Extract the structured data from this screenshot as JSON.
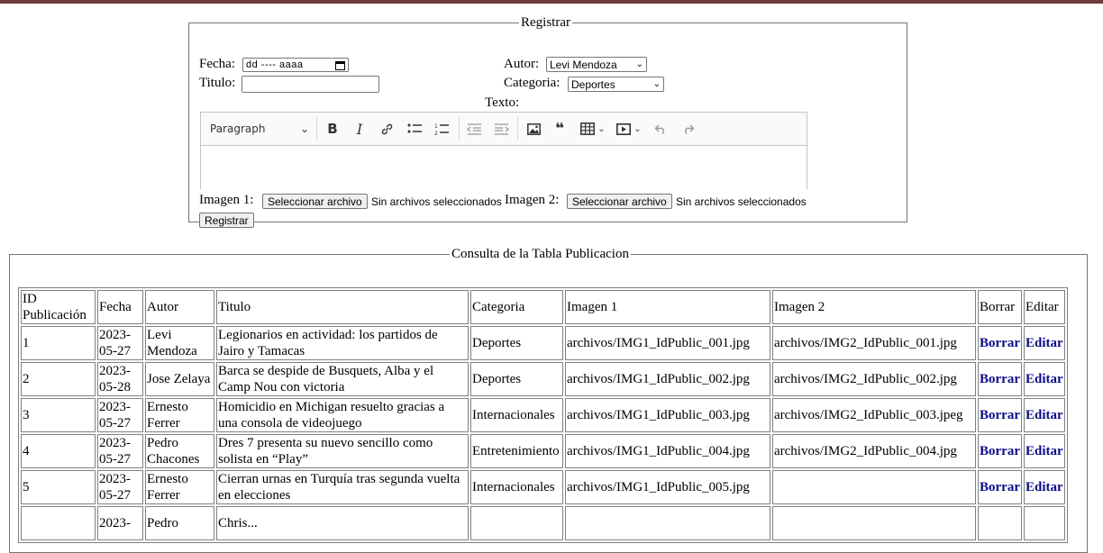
{
  "registro": {
    "legend": "Registrar",
    "fecha_label": "Fecha:",
    "fecha_placeholder": "dd ---- aaaa",
    "autor_label": "Autor:",
    "autor_value": "Levi Mendoza",
    "titulo_label": "Titulo:",
    "titulo_value": "",
    "categoria_label": "Categoria:",
    "categoria_value": "Deportes",
    "texto_label": "Texto:",
    "editor": {
      "heading_select": "Paragraph",
      "tools": [
        "bold-icon",
        "italic-icon",
        "link-icon",
        "bulleted-list-icon",
        "numbered-list-icon",
        "outdent-icon",
        "indent-icon",
        "image-icon",
        "blockquote-icon",
        "table-icon",
        "media-icon",
        "undo-icon",
        "redo-icon"
      ]
    },
    "imagen1_label": "Imagen 1:",
    "imagen2_label": "Imagen 2:",
    "file_button": "Seleccionar archivo",
    "file_status": "Sin archivos seleccionados",
    "submit_label": "Registrar"
  },
  "consulta": {
    "legend": "Consulta de la Tabla Publicacion",
    "headers": [
      "ID Publicación",
      "Fecha",
      "Autor",
      "Titulo",
      "Categoria",
      "Imagen 1",
      "Imagen 2",
      "Borrar",
      "Editar"
    ],
    "rows": [
      {
        "id": "1",
        "fecha": "2023-05-27",
        "autor": "Levi Mendoza",
        "titulo": "Legionarios en actividad: los partidos de Jairo y Tamacas",
        "categoria": "Deportes",
        "imagen1": "archivos/IMG1_IdPublic_001.jpg",
        "imagen2": "archivos/IMG2_IdPublic_001.jpg",
        "borrar": "Borrar",
        "editar": "Editar"
      },
      {
        "id": "2",
        "fecha": "2023-05-28",
        "autor": "Jose Zelaya",
        "titulo": "Barca se despide de Busquets, Alba y el Camp Nou con victoria",
        "categoria": "Deportes",
        "imagen1": "archivos/IMG1_IdPublic_002.jpg",
        "imagen2": "archivos/IMG2_IdPublic_002.jpg",
        "borrar": "Borrar",
        "editar": "Editar"
      },
      {
        "id": "3",
        "fecha": "2023-05-27",
        "autor": "Ernesto Ferrer",
        "titulo": "Homicidio en Michigan resuelto gracias a una consola de videojuego",
        "categoria": "Internacionales",
        "imagen1": "archivos/IMG1_IdPublic_003.jpg",
        "imagen2": "archivos/IMG2_IdPublic_003.jpeg",
        "borrar": "Borrar",
        "editar": "Editar"
      },
      {
        "id": "4",
        "fecha": "2023-05-27",
        "autor": "Pedro Chacones",
        "titulo": "Dres 7 presenta su nuevo sencillo como solista en “Play”",
        "categoria": "Entretenimiento",
        "imagen1": "archivos/IMG1_IdPublic_004.jpg",
        "imagen2": "archivos/IMG2_IdPublic_004.jpg",
        "borrar": "Borrar",
        "editar": "Editar"
      },
      {
        "id": "5",
        "fecha": "2023-05-27",
        "autor": "Ernesto Ferrer",
        "titulo": "Cierran urnas en Turquía tras segunda vuelta en elecciones",
        "categoria": "Internacionales",
        "imagen1": "archivos/IMG1_IdPublic_005.jpg",
        "imagen2": "",
        "borrar": "Borrar",
        "editar": "Editar"
      },
      {
        "id": "",
        "fecha": "2023-",
        "autor": "Pedro",
        "titulo": "Chris...",
        "categoria": "",
        "imagen1": "",
        "imagen2": "",
        "borrar": "",
        "editar": ""
      }
    ]
  },
  "colors": {
    "topbar": "#6e3a3a",
    "link": "#0b0b8a",
    "border": "#808080"
  }
}
